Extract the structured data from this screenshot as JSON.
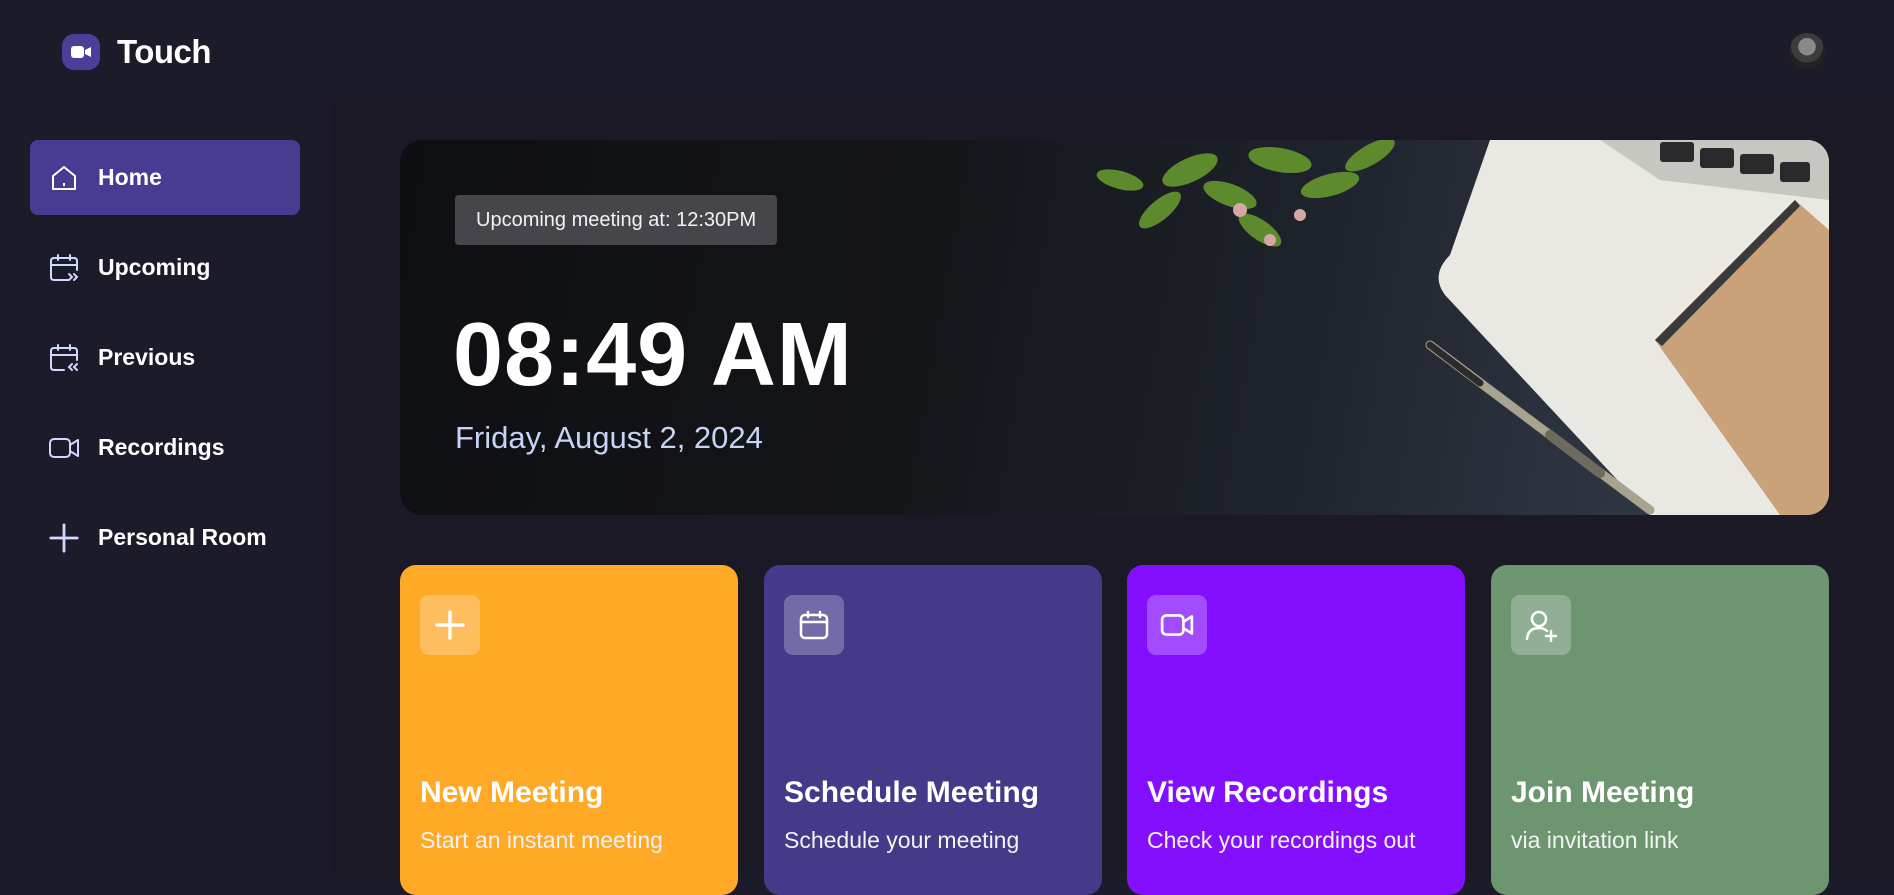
{
  "app": {
    "name": "Touch",
    "icon": "video-camera-icon"
  },
  "user": {
    "avatar": "user-avatar"
  },
  "sidebar": {
    "items": [
      {
        "label": "Home",
        "icon": "home-icon",
        "active": true
      },
      {
        "label": "Upcoming",
        "icon": "calendar-upcoming-icon",
        "active": false
      },
      {
        "label": "Previous",
        "icon": "calendar-previous-icon",
        "active": false
      },
      {
        "label": "Recordings",
        "icon": "video-icon",
        "active": false
      },
      {
        "label": "Personal Room",
        "icon": "plus-icon",
        "active": false
      }
    ]
  },
  "hero": {
    "upcoming": "Upcoming meeting at: 12:30PM",
    "time": "08:49 AM",
    "date": "Friday, August 2, 2024"
  },
  "cards": [
    {
      "title": "New Meeting",
      "subtitle": "Start an instant meeting",
      "icon": "plus-icon",
      "color": "#ffa927"
    },
    {
      "title": "Schedule Meeting",
      "subtitle": "Schedule your meeting",
      "icon": "calendar-icon",
      "color": "#433a8a"
    },
    {
      "title": "View Recordings",
      "subtitle": "Check your recordings out",
      "icon": "video-icon",
      "color": "#840fff"
    },
    {
      "title": "Join Meeting",
      "subtitle": "via invitation link",
      "icon": "user-add-icon",
      "color": "#6d9570"
    }
  ],
  "colors": {
    "background": "#1c1b29",
    "accent": "#473c92",
    "date_text": "#c9d3f3"
  }
}
